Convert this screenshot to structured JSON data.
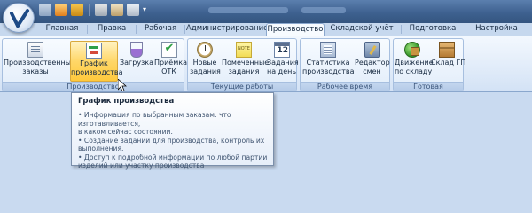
{
  "quick_access": {
    "more_glyph": "▾"
  },
  "tabs": [
    {
      "label": "Главная"
    },
    {
      "label": "Правка"
    },
    {
      "label": "Рабочая"
    },
    {
      "label": "Администрирование"
    },
    {
      "label": "Производство"
    },
    {
      "label": "Складской учёт"
    },
    {
      "label": "Подготовка"
    },
    {
      "label": "Настройка"
    }
  ],
  "ribbon": {
    "groups": [
      {
        "label": "Производство",
        "buttons": [
          {
            "label_1": "Производственные",
            "label_2": "заказы",
            "icon": "orders-doc-icon"
          },
          {
            "label_1": "График",
            "label_2": "производства",
            "icon": "schedule-chart-icon"
          },
          {
            "label_1": "Загрузка",
            "label_2": "",
            "icon": "loading-flask-icon"
          },
          {
            "label_1": "Приёмка",
            "label_2": "ОТК",
            "icon": "acceptance-check-icon"
          }
        ]
      },
      {
        "label": "Текущие работы",
        "buttons": [
          {
            "label_1": "Новые",
            "label_2": "задания",
            "icon": "clock-icon"
          },
          {
            "label_1": "Помеченные",
            "label_2": "задания",
            "icon": "note-icon"
          },
          {
            "label_1": "Задания",
            "label_2": "на день",
            "icon": "calendar-icon"
          }
        ]
      },
      {
        "label": "Рабочее время",
        "buttons": [
          {
            "label_1": "Статистика",
            "label_2": "производства",
            "icon": "statistics-icon"
          },
          {
            "label_1": "Редактор",
            "label_2": "смен",
            "icon": "shift-editor-icon"
          }
        ]
      },
      {
        "label": "Готовая продукция",
        "buttons": [
          {
            "label_1": "Движение",
            "label_2": "по складу",
            "icon": "warehouse-move-icon"
          },
          {
            "label_1": "Склад ГП",
            "label_2": "",
            "icon": "box-icon"
          }
        ]
      }
    ]
  },
  "tooltip": {
    "title": "График производства",
    "lines": [
      "• Информация по выбранным заказам: что изготавливается,",
      "  в каком сейчас состоянии.",
      "• Создание заданий для производства, контроль их",
      "  выполнения.",
      "• Доступ к подробной информации по любой партии",
      "  изделий или участку производства"
    ]
  },
  "colors": {
    "titlebar": "#3e6190",
    "ribbon_bg": "#dde9f8",
    "hover": "#ffd768",
    "workspace": "#c9daf0"
  }
}
